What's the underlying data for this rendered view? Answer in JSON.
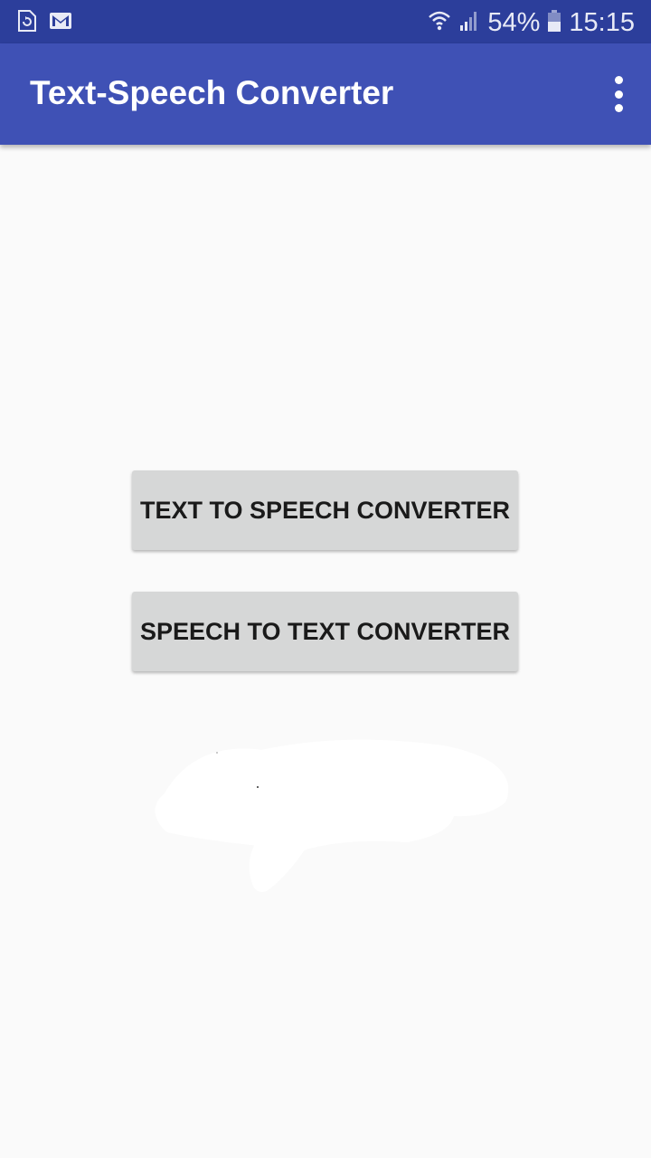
{
  "status_bar": {
    "battery_percent": "54%",
    "time": "15:15",
    "icons": [
      "screenshot-notification-icon",
      "gmail-icon",
      "wifi-icon",
      "signal-icon",
      "battery-icon"
    ]
  },
  "app_bar": {
    "title": "Text-Speech Converter",
    "menu_icon": "overflow-menu-icon"
  },
  "main": {
    "text_to_speech_label": "TEXT TO SPEECH CONVERTER",
    "speech_to_text_label": "SPEECH TO TEXT CONVERTER"
  },
  "colors": {
    "status_bar": "#2c3e9b",
    "app_bar": "#3f51b5",
    "background": "#fafafa",
    "button": "#d6d7d7",
    "button_text": "#1a1a1a"
  }
}
